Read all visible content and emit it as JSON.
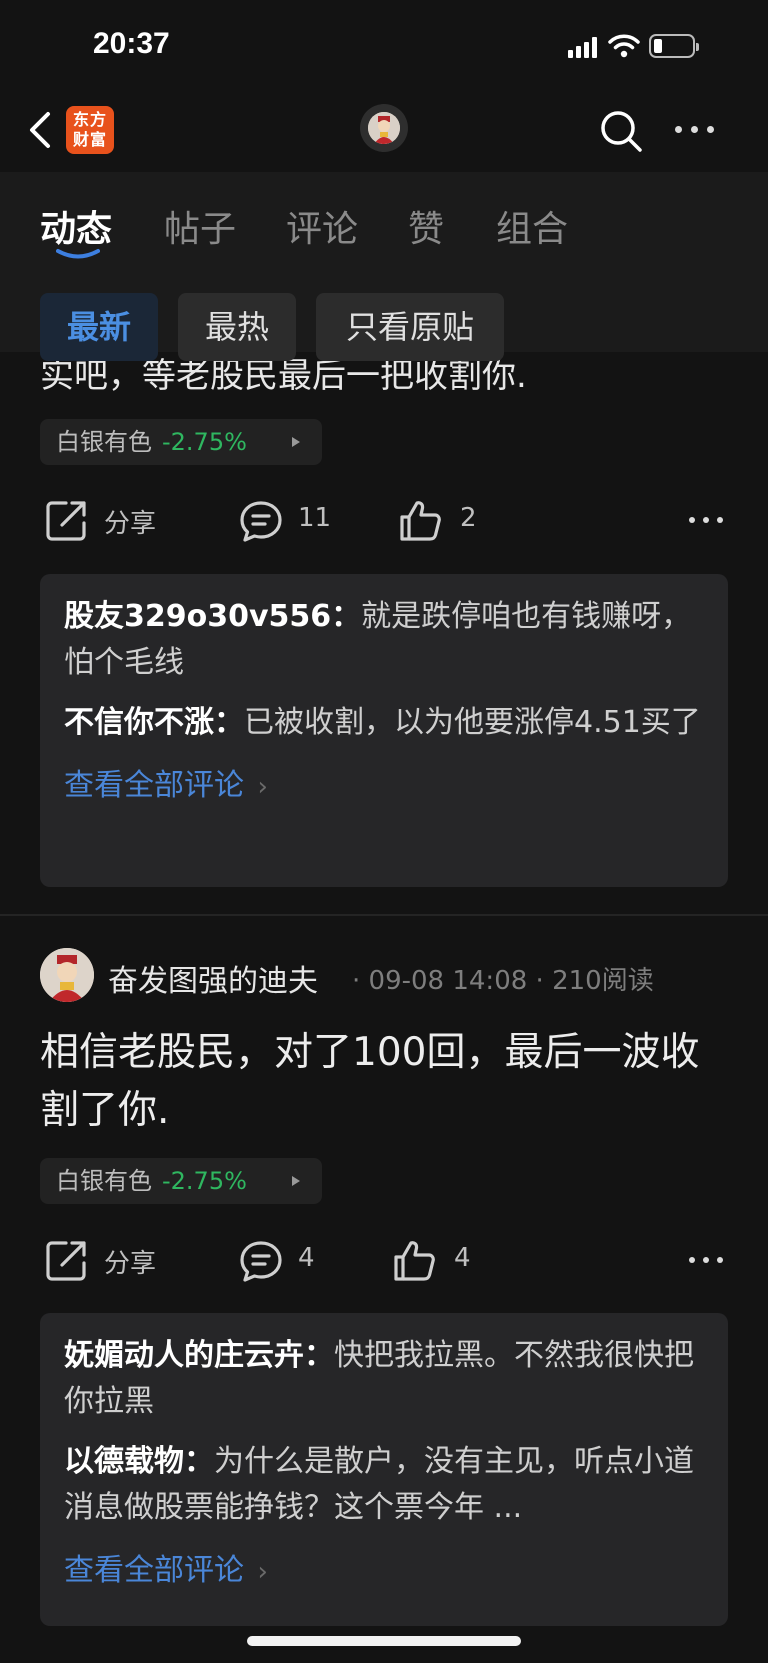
{
  "status_bar": {
    "time": "20:37"
  },
  "nav": {
    "logo_line1": "东方",
    "logo_line2": "财富"
  },
  "tabs": [
    {
      "label": "动态",
      "active": true
    },
    {
      "label": "帖子"
    },
    {
      "label": "评论"
    },
    {
      "label": "赞"
    },
    {
      "label": "组合"
    }
  ],
  "filters": [
    {
      "label": "最新",
      "active": true
    },
    {
      "label": "最热"
    },
    {
      "label": "只看原贴"
    }
  ],
  "post1": {
    "partial_text": "实吧，等老股民最后一把收割你.",
    "stock": {
      "name": "白银有色",
      "change": "-2.75%"
    },
    "actions": {
      "share": "分享",
      "comments": "11",
      "likes": "2"
    },
    "comments": [
      {
        "author": "股友329o30v556：",
        "text": "就是跌停咱也有钱赚呀，怕个毛线"
      },
      {
        "author": "不信你不涨：",
        "text": "已被收割，以为他要涨停4.51买了"
      }
    ],
    "view_all": "查看全部评论"
  },
  "post2": {
    "author": "奋发图强的迪夫",
    "meta": "· 09-08 14:08 · 210阅读",
    "body": "相信老股民，对了100回，最后一波收割了你.",
    "stock": {
      "name": "白银有色",
      "change": "-2.75%"
    },
    "actions": {
      "share": "分享",
      "comments": "4",
      "likes": "4"
    },
    "comments": [
      {
        "author": "妩媚动人的庄云卉：",
        "text": "快把我拉黑。不然我很快把你拉黑"
      },
      {
        "author": "以德载物：",
        "text": "为什么是散户，没有主见，听点小道消息做股票能挣钱？这个票今年 ..."
      }
    ],
    "view_all": "查看全部评论"
  },
  "colors": {
    "accent": "#4b8fe2",
    "down": "#2fb760",
    "logo": "#e8521c"
  }
}
